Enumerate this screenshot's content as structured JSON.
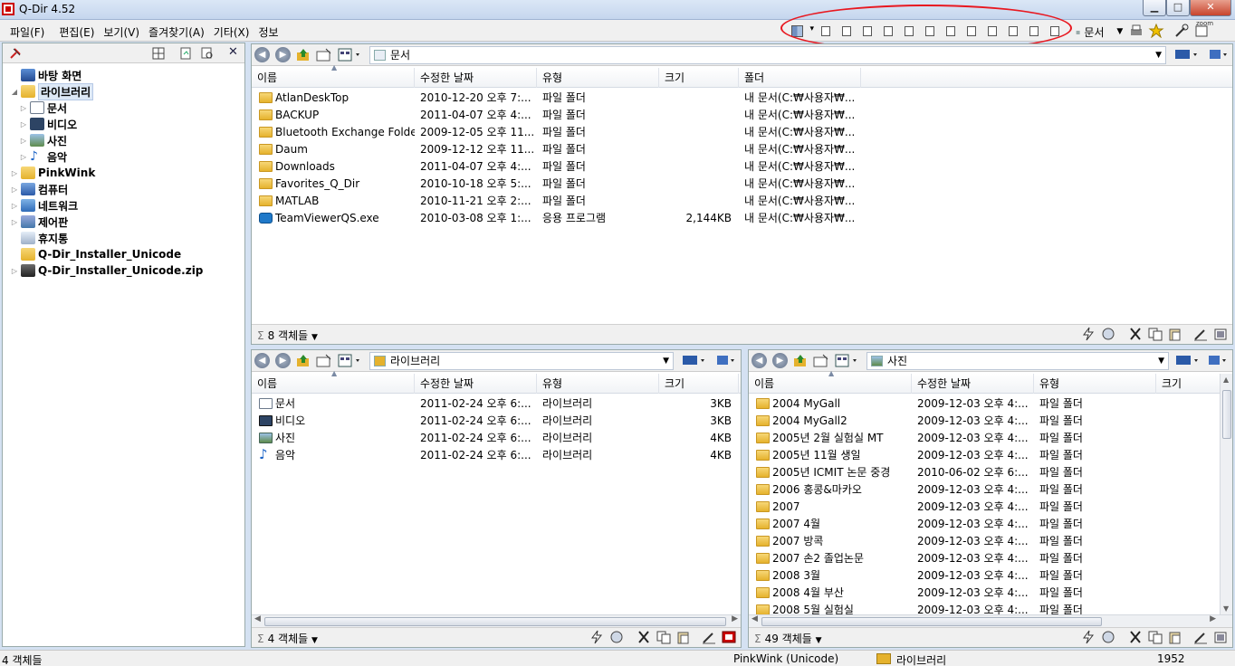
{
  "window": {
    "title": "Q-Dir 4.52",
    "minimize": "▁",
    "maximize": "□",
    "close": "✕"
  },
  "menu": [
    "파일(F)",
    "편집(E)",
    "보기(V)",
    "즐겨찾기(A)",
    "기타(X)",
    "정보"
  ],
  "toolbar": {
    "document_label": "문서",
    "zoom_label": "zoom"
  },
  "tree": [
    {
      "label": "바탕 화면",
      "bold": true,
      "icon": "desktop-icon",
      "indent": 0,
      "expander": ""
    },
    {
      "label": "라이브러리",
      "bold": true,
      "icon": "library-icon",
      "indent": 0,
      "expander": "◢",
      "selected": true
    },
    {
      "label": "문서",
      "bold": true,
      "icon": "document-icon",
      "indent": 1,
      "expander": "▷"
    },
    {
      "label": "비디오",
      "bold": true,
      "icon": "video-icon",
      "indent": 1,
      "expander": "▷"
    },
    {
      "label": "사진",
      "bold": true,
      "icon": "picture-icon",
      "indent": 1,
      "expander": "▷"
    },
    {
      "label": "음악",
      "bold": true,
      "icon": "music-icon",
      "indent": 1,
      "expander": "▷"
    },
    {
      "label": "PinkWink",
      "bold": true,
      "icon": "user-folder-icon",
      "indent": 0,
      "expander": "▷"
    },
    {
      "label": "컴퓨터",
      "bold": true,
      "icon": "computer-icon",
      "indent": 0,
      "expander": "▷"
    },
    {
      "label": "네트워크",
      "bold": true,
      "icon": "network-icon",
      "indent": 0,
      "expander": "▷"
    },
    {
      "label": "제어판",
      "bold": true,
      "icon": "control-panel-icon",
      "indent": 0,
      "expander": "▷"
    },
    {
      "label": "휴지통",
      "bold": true,
      "icon": "recycle-bin-icon",
      "indent": 0,
      "expander": ""
    },
    {
      "label": "Q-Dir_Installer_Unicode",
      "bold": true,
      "icon": "folder-icon",
      "indent": 0,
      "expander": ""
    },
    {
      "label": "Q-Dir_Installer_Unicode.zip",
      "bold": true,
      "icon": "zip-icon",
      "indent": 0,
      "expander": "▷"
    }
  ],
  "pane_top": {
    "address": "문서",
    "columns": [
      "이름",
      "수정한 날짜",
      "유형",
      "크기",
      "폴더"
    ],
    "rows": [
      {
        "name": "AtlanDeskTop",
        "date": "2010-12-20 오후 7:...",
        "type": "파일 폴더",
        "size": "",
        "folder": "내 문서(C:₩사용자₩...",
        "icon": "folder"
      },
      {
        "name": "BACKUP",
        "date": "2011-04-07 오후 4:...",
        "type": "파일 폴더",
        "size": "",
        "folder": "내 문서(C:₩사용자₩...",
        "icon": "folder"
      },
      {
        "name": "Bluetooth Exchange Folder",
        "date": "2009-12-05 오후 11...",
        "type": "파일 폴더",
        "size": "",
        "folder": "내 문서(C:₩사용자₩...",
        "icon": "folder"
      },
      {
        "name": "Daum",
        "date": "2009-12-12 오후 11...",
        "type": "파일 폴더",
        "size": "",
        "folder": "내 문서(C:₩사용자₩...",
        "icon": "folder"
      },
      {
        "name": "Downloads",
        "date": "2011-04-07 오후 4:...",
        "type": "파일 폴더",
        "size": "",
        "folder": "내 문서(C:₩사용자₩...",
        "icon": "folder"
      },
      {
        "name": "Favorites_Q_Dir",
        "date": "2010-10-18 오후 5:...",
        "type": "파일 폴더",
        "size": "",
        "folder": "내 문서(C:₩사용자₩...",
        "icon": "folder"
      },
      {
        "name": "MATLAB",
        "date": "2010-11-21 오후 2:...",
        "type": "파일 폴더",
        "size": "",
        "folder": "내 문서(C:₩사용자₩...",
        "icon": "folder"
      },
      {
        "name": "TeamViewerQS.exe",
        "date": "2010-03-08 오후 1:...",
        "type": "응용 프로그램",
        "size": "2,144KB",
        "folder": "내 문서(C:₩사용자₩...",
        "icon": "exe"
      }
    ],
    "status": "8 객체들"
  },
  "pane_bl": {
    "address": "라이브러리",
    "columns": [
      "이름",
      "수정한 날짜",
      "유형",
      "크기"
    ],
    "rows": [
      {
        "name": "문서",
        "date": "2011-02-24 오후 6:...",
        "type": "라이브러리",
        "size": "3KB",
        "icon": "doc"
      },
      {
        "name": "비디오",
        "date": "2011-02-24 오후 6:...",
        "type": "라이브러리",
        "size": "3KB",
        "icon": "vid"
      },
      {
        "name": "사진",
        "date": "2011-02-24 오후 6:...",
        "type": "라이브러리",
        "size": "4KB",
        "icon": "pic"
      },
      {
        "name": "음악",
        "date": "2011-02-24 오후 6:...",
        "type": "라이브러리",
        "size": "4KB",
        "icon": "mus"
      }
    ],
    "status": "4 객체들"
  },
  "pane_br": {
    "address": "사진",
    "columns": [
      "이름",
      "수정한 날짜",
      "유형",
      "크기"
    ],
    "rows": [
      {
        "name": "2004 MyGall",
        "date": "2009-12-03 오후 4:...",
        "type": "파일 폴더",
        "size": "",
        "icon": "folder"
      },
      {
        "name": "2004 MyGall2",
        "date": "2009-12-03 오후 4:...",
        "type": "파일 폴더",
        "size": "",
        "icon": "folder"
      },
      {
        "name": "2005년 2월 실험실 MT",
        "date": "2009-12-03 오후 4:...",
        "type": "파일 폴더",
        "size": "",
        "icon": "folder"
      },
      {
        "name": "2005년 11월 생일",
        "date": "2009-12-03 오후 4:...",
        "type": "파일 폴더",
        "size": "",
        "icon": "folder"
      },
      {
        "name": "2005년 ICMIT 논문 중경",
        "date": "2010-06-02 오후 6:...",
        "type": "파일 폴더",
        "size": "",
        "icon": "folder"
      },
      {
        "name": "2006 홍콩&마카오",
        "date": "2009-12-03 오후 4:...",
        "type": "파일 폴더",
        "size": "",
        "icon": "folder"
      },
      {
        "name": "2007",
        "date": "2009-12-03 오후 4:...",
        "type": "파일 폴더",
        "size": "",
        "icon": "folder"
      },
      {
        "name": "2007 4월",
        "date": "2009-12-03 오후 4:...",
        "type": "파일 폴더",
        "size": "",
        "icon": "folder"
      },
      {
        "name": "2007 방콕",
        "date": "2009-12-03 오후 4:...",
        "type": "파일 폴더",
        "size": "",
        "icon": "folder"
      },
      {
        "name": "2007 손2 졸업논문",
        "date": "2009-12-03 오후 4:...",
        "type": "파일 폴더",
        "size": "",
        "icon": "folder"
      },
      {
        "name": "2008 3월",
        "date": "2009-12-03 오후 4:...",
        "type": "파일 폴더",
        "size": "",
        "icon": "folder"
      },
      {
        "name": "2008 4월 부산",
        "date": "2009-12-03 오후 4:...",
        "type": "파일 폴더",
        "size": "",
        "icon": "folder"
      },
      {
        "name": "2008 5월 실험실",
        "date": "2009-12-03 오후 4:...",
        "type": "파일 폴더",
        "size": "",
        "icon": "folder"
      }
    ],
    "status": "49 객체들"
  },
  "statusbar": {
    "left": "4 객체들",
    "user": "PinkWink (Unicode)",
    "location": "라이브러리",
    "number": "1952"
  },
  "colors": {
    "annotation": "#e81820",
    "folder": "#e5b22d",
    "selection": "#dde8f6"
  }
}
